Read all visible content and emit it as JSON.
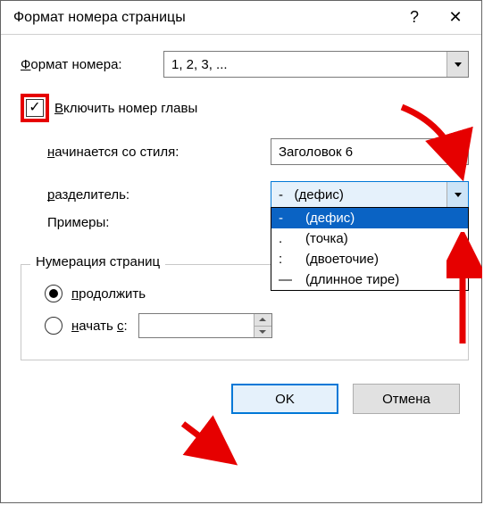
{
  "titlebar": {
    "title": "Формат номера страницы",
    "help": "?",
    "close": "✕"
  },
  "format": {
    "label_pre": "Ф",
    "label_mid": "ормат номера:",
    "value": "1, 2, 3, ..."
  },
  "include_chapter": {
    "label_pre": "В",
    "label_rest": "ключить номер главы",
    "checked": "✓"
  },
  "starts_with": {
    "label_pre": "н",
    "label_rest": "ачинается со стиля:",
    "value": "Заголовок 6"
  },
  "separator": {
    "label_pre": "р",
    "label_rest": "азделитель:",
    "value_sym": "-",
    "value_txt": "(дефис)",
    "options": [
      {
        "sym": "-",
        "txt": "(дефис)"
      },
      {
        "sym": ".",
        "txt": "(точка)"
      },
      {
        "sym": ":",
        "txt": "(двоеточие)"
      },
      {
        "sym": "—",
        "txt": "(длинное тире)"
      }
    ]
  },
  "examples_label": "Примеры:",
  "numbering": {
    "group_title": "Нумерация страниц",
    "continue_pre": "п",
    "continue_rest": "родолжить",
    "startat_pre": "н",
    "startat_rest": "ачать ",
    "startat_under": "с",
    "startat_tail": ":",
    "startat_value": ""
  },
  "buttons": {
    "ok": "OK",
    "cancel": "Отмена"
  }
}
